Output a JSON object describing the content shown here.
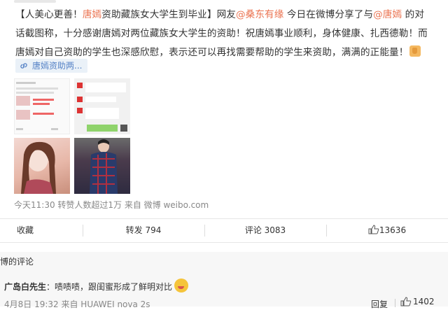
{
  "post": {
    "line1_a": "【人美心更善！",
    "line1_name": "唐嫣",
    "line1_b": "资助藏族女大学生到毕业】网友",
    "mention1": "@桑东有缘",
    "line1_c": "今日在微博分享了与",
    "mention2": "@唐嫣",
    "line1_d": "的对",
    "line2": "话截图称，十分感谢唐嫣对两位藏族女大学生的资助！祝唐嫣事业顺利，身体健康、扎西德勒！而",
    "line3": "唐嫣对自己资助的学生也深感欣慰，表示还可以再找需要帮助的学生来资助，满满的正能量！",
    "link_card_label": "唐嫣资助两...",
    "meta": "今天11:30 转赞人数超过1万 来自 微博 weibo.com"
  },
  "actions": {
    "favorite": "收藏",
    "repost": "转发 794",
    "comment": "评论 3083",
    "like": "13636"
  },
  "comments": {
    "title": "博的评论",
    "items": [
      {
        "user": "广岛白先生",
        "text": "：啧啧啧，跟闺蜜形成了鲜明对比",
        "time": "4月8日 19:32 来自 HUAWEI nova 2s",
        "reply": "回复",
        "likes": "1402"
      }
    ]
  },
  "colors": {
    "accent": "#eb7350",
    "link": "#5582c6",
    "meta": "#888888"
  }
}
